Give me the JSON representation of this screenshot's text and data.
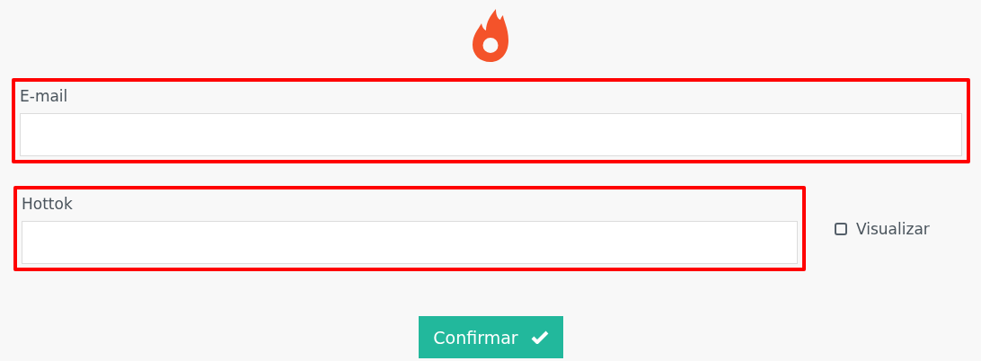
{
  "fields": [
    {
      "label": "E-mail",
      "highlighted": true
    },
    {
      "label": "Hottok",
      "highlighted": true
    }
  ],
  "show_checkbox": {
    "label": "Visualizar",
    "checked": false
  },
  "confirm_button": {
    "label": "Confirmar"
  }
}
